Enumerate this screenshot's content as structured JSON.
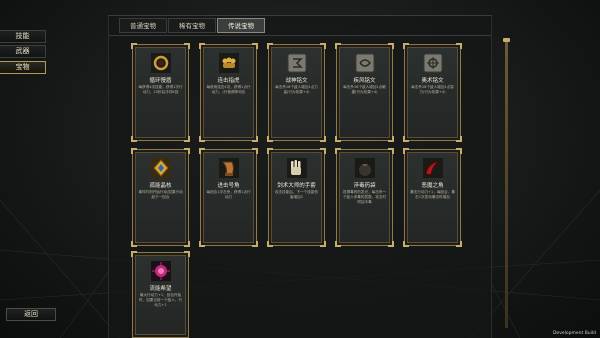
{
  "sidebar": {
    "items": [
      {
        "label": "技能"
      },
      {
        "label": "武器"
      },
      {
        "label": "宝物"
      }
    ],
    "active": "宝物"
  },
  "tabs": [
    {
      "label": "普通宝物"
    },
    {
      "label": "稀有宝物"
    },
    {
      "label": "传说宝物"
    }
  ],
  "active_tab": "传说宝物",
  "cards": [
    {
      "name": "循环慢盾",
      "desc": "每获得4次技能，获得1次行动力，10秒后冷却4回",
      "icon": "ring-icon"
    },
    {
      "name": "连击指虎",
      "desc": "每使用连击4次，获得1点行动力，(行使频率5回)",
      "icon": "knuckle-icon"
    },
    {
      "name": "战神铭文",
      "desc": "每击杀18个敌人增加1点力量(行为效果+4)",
      "icon": "rune-tablet-icon"
    },
    {
      "name": "疾风铭文",
      "desc": "每击杀18个敌人增加1点敏捷(行为效果+4)",
      "icon": "rune-tablet-icon"
    },
    {
      "name": "奥术铭文",
      "desc": "每击杀18个敌人增加1点智力(行为效果+4)",
      "icon": "rune-tablet-icon"
    },
    {
      "name": "孤能晶核",
      "desc": "事件时刻开始行动/如果行动起于一回合",
      "icon": "crystal-icon"
    },
    {
      "name": "进击号角",
      "desc": "每回合1次击杀，获得1点行动力",
      "icon": "horn-icon"
    },
    {
      "name": "剑术大师的手套",
      "desc": "攻击技能后，下一个技能伤害增加2",
      "icon": "gauntlet-icon"
    },
    {
      "name": "淬毒药袋",
      "desc": "投掷毒药的发光，每击杀一个敌人来毒的层数，攻击时附加中毒",
      "icon": "pouch-icon"
    },
    {
      "name": "恶魔之角",
      "desc": "暴击行动力+1，每回合，暴击1次发动暴击时增加",
      "icon": "demon-horn-icon"
    },
    {
      "name": "流能希望",
      "desc": "最大行动力+1，回合开始时，如果当前一个敌人，行动力+1",
      "icon": "orb-icon"
    }
  ],
  "back_label": "返回",
  "footer": "Development Build",
  "colors": {
    "gold": "#c9ad6a",
    "card_border": "#8f7a48",
    "panel_bg": "#141615"
  }
}
